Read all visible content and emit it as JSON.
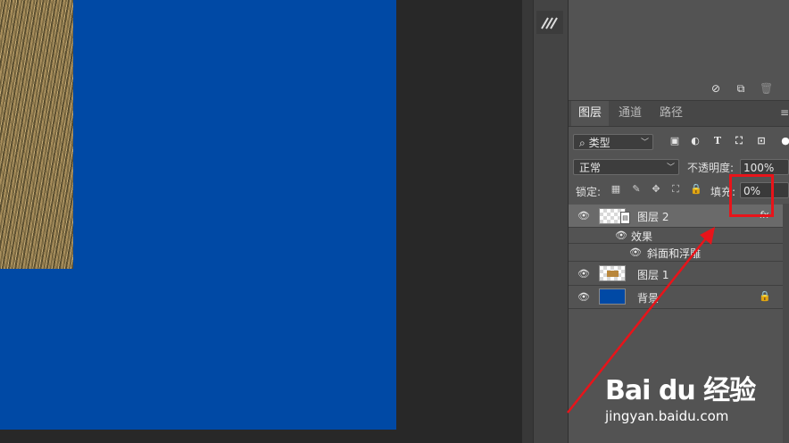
{
  "layers_panel": {
    "tabs": [
      {
        "label": "图层",
        "active": true
      },
      {
        "label": "通道",
        "active": false
      },
      {
        "label": "路径",
        "active": false
      }
    ],
    "filter_kind": "类型",
    "filter_icons": [
      "image-filter-icon",
      "adjustment-filter-icon",
      "type-filter-icon",
      "shape-filter-icon",
      "smart-object-filter-icon",
      "toggle-filter-icon"
    ],
    "blend_mode": "正常",
    "opacity_label": "不透明度:",
    "opacity_value": "100%",
    "lock_label": "锁定:",
    "lock_icons": [
      "lock-transparent-icon",
      "lock-paint-icon",
      "lock-position-icon",
      "lock-artboard-icon",
      "lock-all-icon"
    ],
    "fill_label": "填充:",
    "fill_value": "0%",
    "layers": [
      {
        "name": "图层 2",
        "selected": true,
        "fx": "fx",
        "effects_label": "效果",
        "effect": "斜面和浮雕"
      },
      {
        "name": "图层 1",
        "selected": false
      },
      {
        "name": "背景",
        "selected": false,
        "locked": true
      }
    ]
  },
  "top_panel_icons": [
    "prohibit-icon",
    "new-item-icon",
    "trash-icon"
  ],
  "watermark": {
    "logo": "Bai du 经验",
    "url": "jingyan.baidu.com"
  },
  "colors": {
    "canvas_blue": "#0049a5",
    "panel_bg": "#535353",
    "highlight_red": "#e8141a"
  }
}
